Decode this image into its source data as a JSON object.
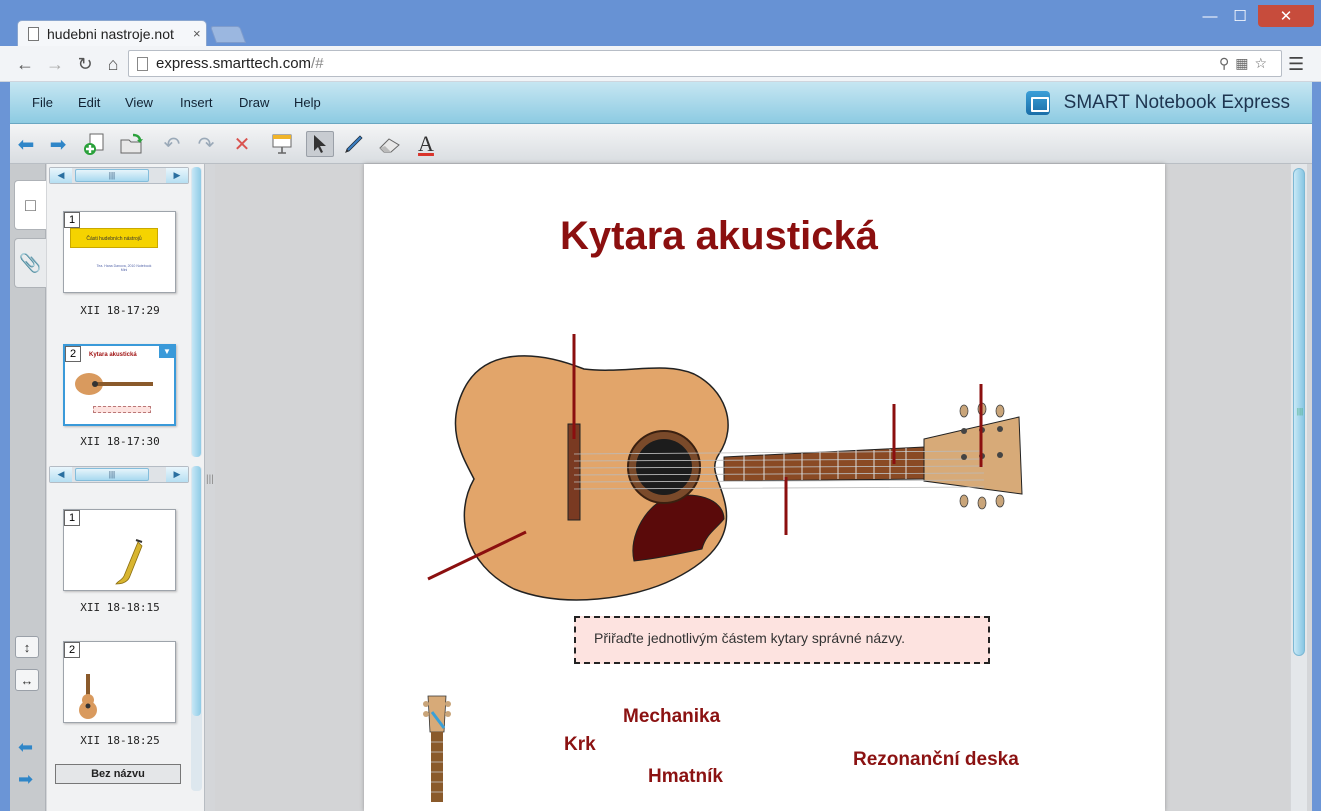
{
  "browser": {
    "tab_title": "hudebni nastroje.not",
    "tab_close": "×",
    "url_domain": "express.smarttech.com",
    "url_rest": "/#",
    "window_min": "—",
    "window_max": "☐",
    "window_close": "✕"
  },
  "app": {
    "brand": "SMART Notebook Express",
    "menu": [
      "File",
      "Edit",
      "View",
      "Insert",
      "Draw",
      "Help"
    ]
  },
  "toolbar": {
    "icons": [
      "back-arrow-icon",
      "forward-arrow-icon",
      "add-page-icon",
      "open-file-icon",
      "undo-icon",
      "redo-icon",
      "delete-icon",
      "screen-shade-icon",
      "select-pointer-icon",
      "pen-icon",
      "eraser-icon",
      "text-icon"
    ]
  },
  "sidebar": {
    "group1": [
      {
        "num": "1",
        "time": "XII 18-17:29",
        "title": "Části hudebních nástrojů",
        "sub": "Tea. Hana Danova, 2010\nNotebook Mini"
      },
      {
        "num": "2",
        "time": "XII 18-17:30",
        "title": "Kytara akustická"
      }
    ],
    "group2": [
      {
        "num": "1",
        "time": "XII 18-18:15"
      },
      {
        "num": "2",
        "time": "XII 18-18:25"
      }
    ],
    "name_box": "Bez názvu"
  },
  "page": {
    "title": "Kytara akustická",
    "instruction": "Přiřaďte jednotlivým částem kytary správné názvy.",
    "labels": [
      "Mechanika",
      "Krk",
      "Hmatník",
      "Rezonanční deska"
    ]
  },
  "colors": {
    "title_red": "#8b0f0f",
    "label_red": "#8b1212",
    "accent_blue": "#3a9ad9"
  }
}
